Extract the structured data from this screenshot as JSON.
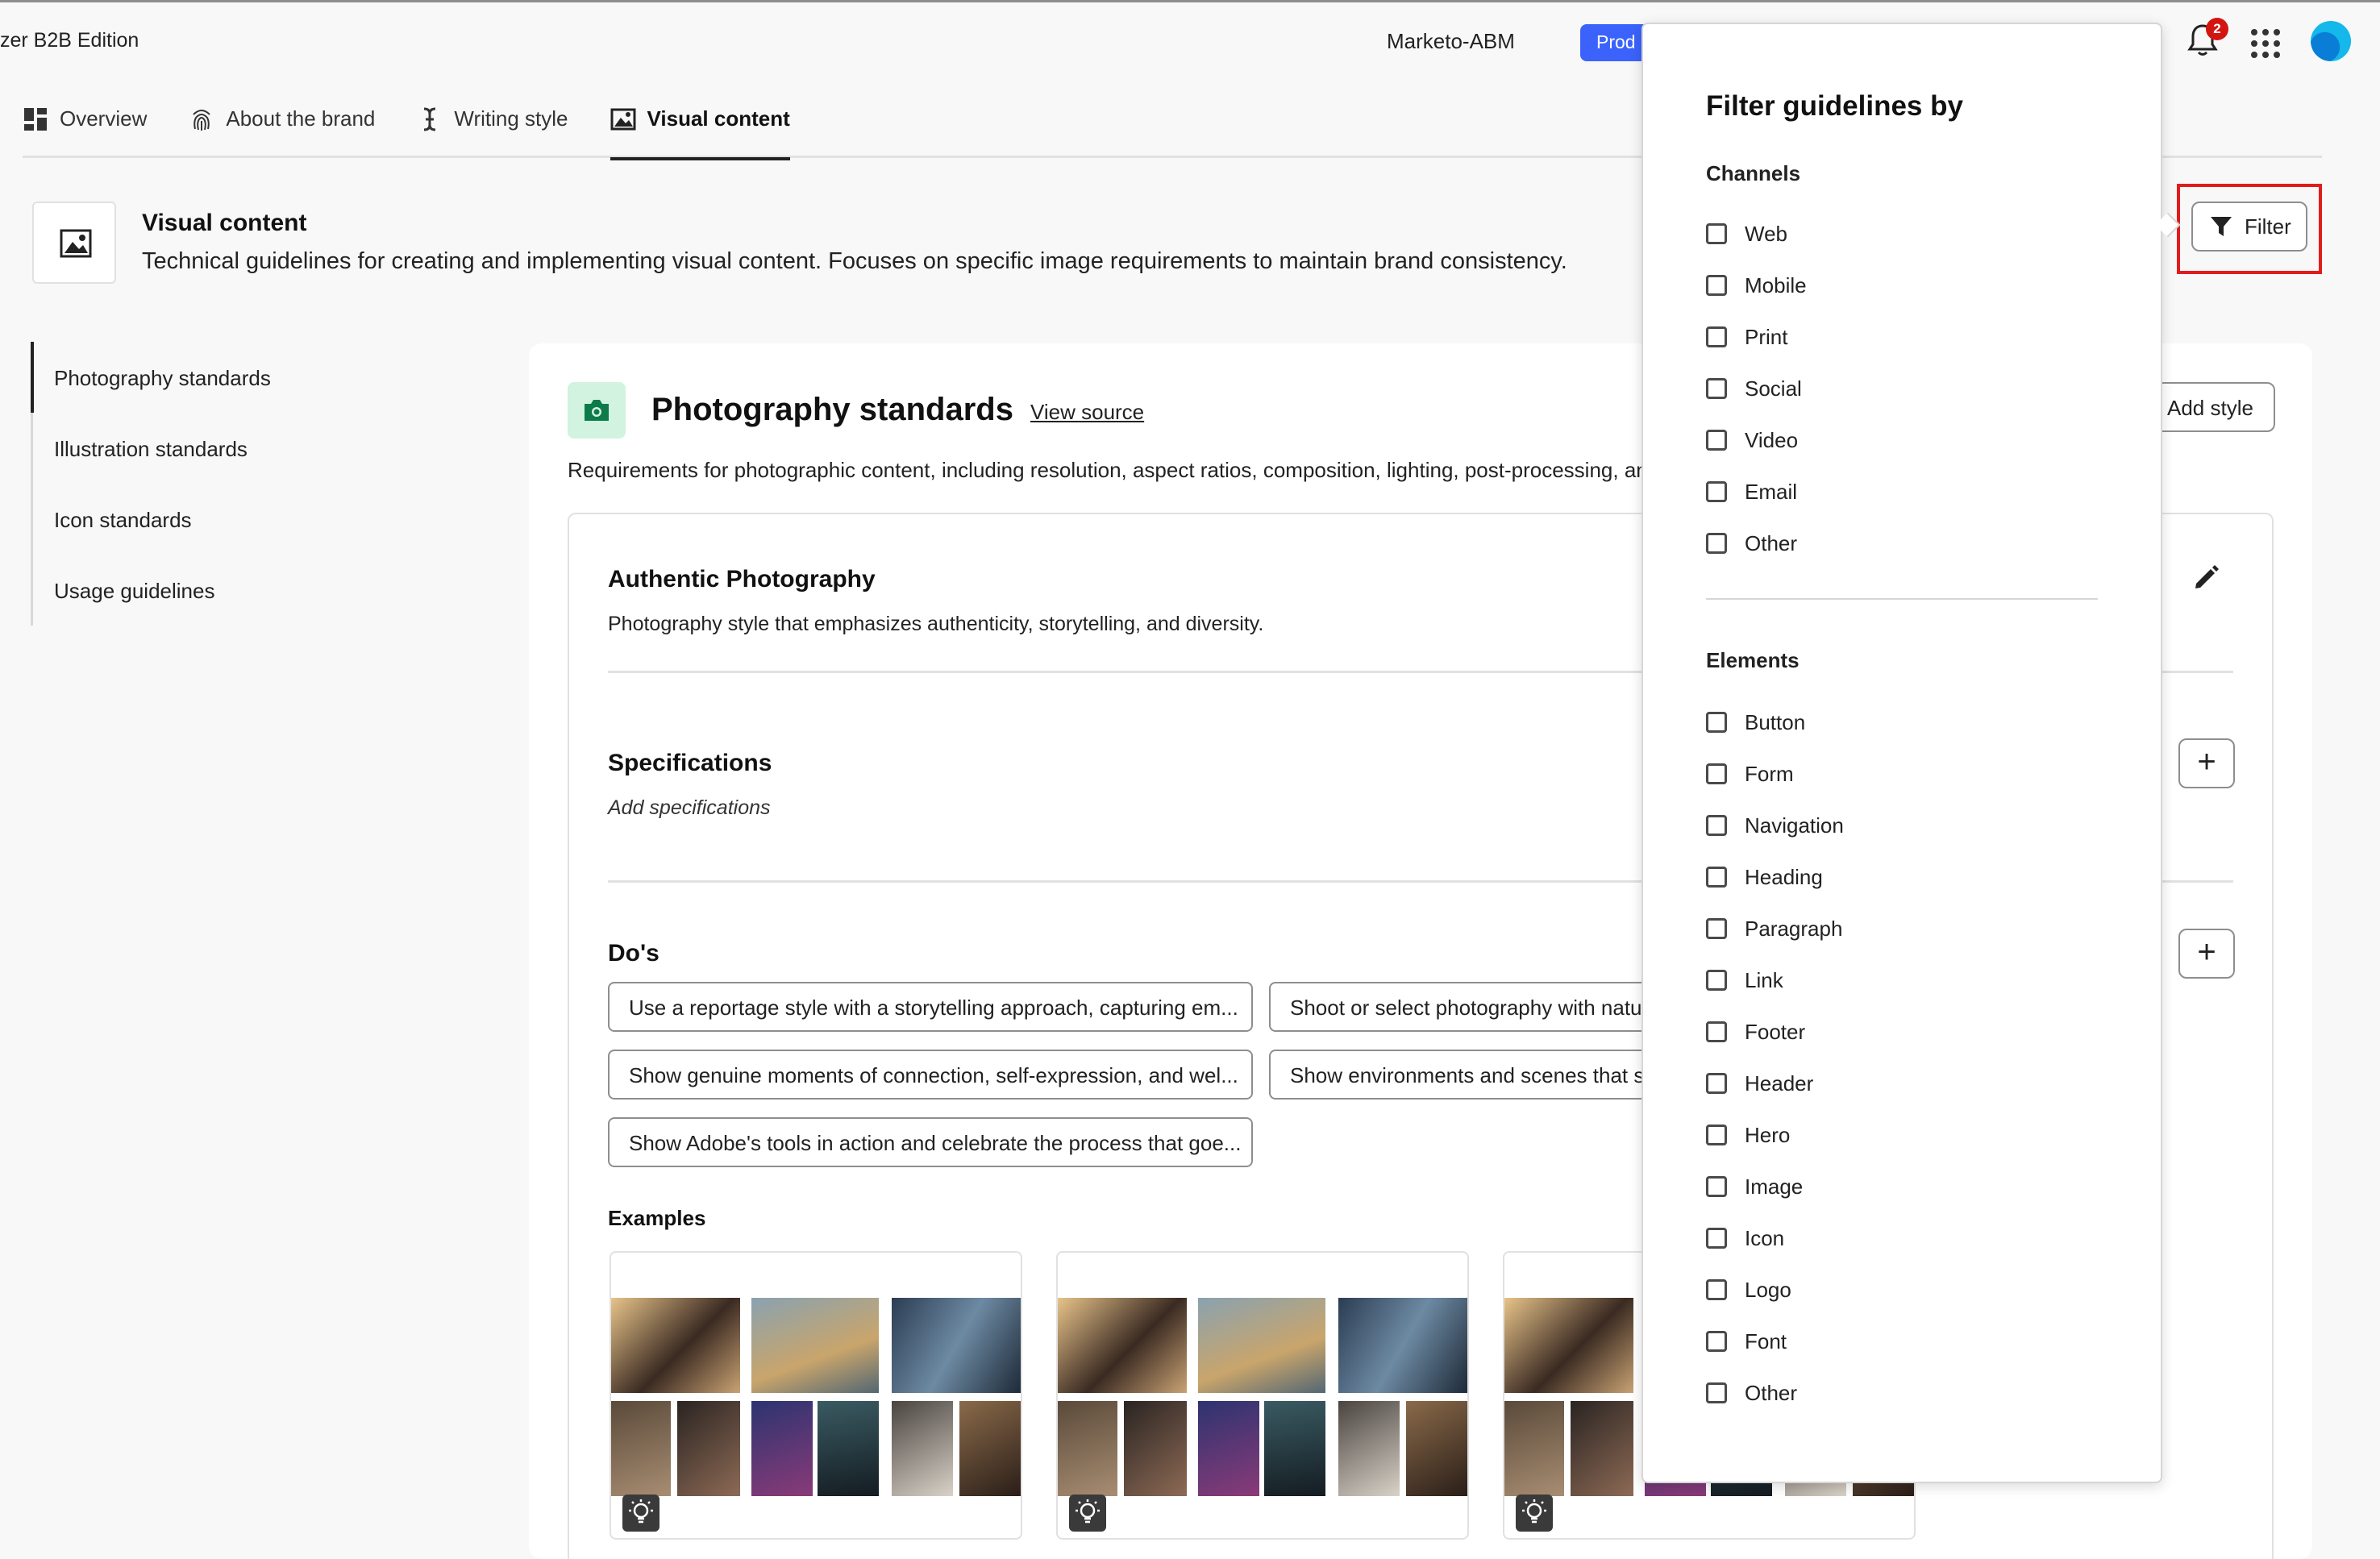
{
  "header": {
    "app_title": "zer B2B Edition",
    "workspace": "Marketo-ABM",
    "environment": "Prod",
    "notification_count": "2"
  },
  "tabs": [
    {
      "label": "Overview",
      "icon": "dashboard-icon"
    },
    {
      "label": "About the brand",
      "icon": "fingerprint-icon"
    },
    {
      "label": "Writing style",
      "icon": "text-cursor-icon"
    },
    {
      "label": "Visual content",
      "icon": "image-icon",
      "active": true
    }
  ],
  "page": {
    "title": "Visual content",
    "description": "Technical guidelines for creating and implementing visual content. Focuses on specific image requirements to maintain brand consistency.",
    "filter_label": "Filter"
  },
  "leftnav": [
    {
      "label": "Photography standards",
      "active": true
    },
    {
      "label": "Illustration standards"
    },
    {
      "label": "Icon standards"
    },
    {
      "label": "Usage guidelines"
    }
  ],
  "section": {
    "title": "Photography standards",
    "view_source": "View source",
    "add_style": "Add style",
    "description": "Requirements for photographic content, including resolution, aspect ratios, composition, lighting, post-processing, and"
  },
  "style": {
    "name": "Authentic Photography",
    "description": "Photography style that emphasizes authenticity, storytelling, and diversity.",
    "specifications_title": "Specifications",
    "add_specifications": "Add specifications",
    "dos_title": "Do's",
    "dos": [
      "Use a reportage style with a storytelling approach, capturing em...",
      "Shoot or select photography with natu",
      "Show genuine moments of connection, self-expression, and wel...",
      "Show environments and scenes that se",
      "Show Adobe's tools in action and celebrate the process that goe..."
    ],
    "examples_title": "Examples"
  },
  "filter_popover": {
    "title": "Filter guidelines by",
    "channels_title": "Channels",
    "channels": [
      "Web",
      "Mobile",
      "Print",
      "Social",
      "Video",
      "Email",
      "Other"
    ],
    "elements_title": "Elements",
    "elements": [
      "Button",
      "Form",
      "Navigation",
      "Heading",
      "Paragraph",
      "Link",
      "Footer",
      "Header",
      "Hero",
      "Image",
      "Icon",
      "Logo",
      "Font",
      "Other"
    ]
  },
  "colors": {
    "accent": "#3b63fb",
    "highlight_border": "#e11c1c",
    "section_icon_bg": "#d1f3e0",
    "section_icon_fg": "#0d7a4a"
  }
}
